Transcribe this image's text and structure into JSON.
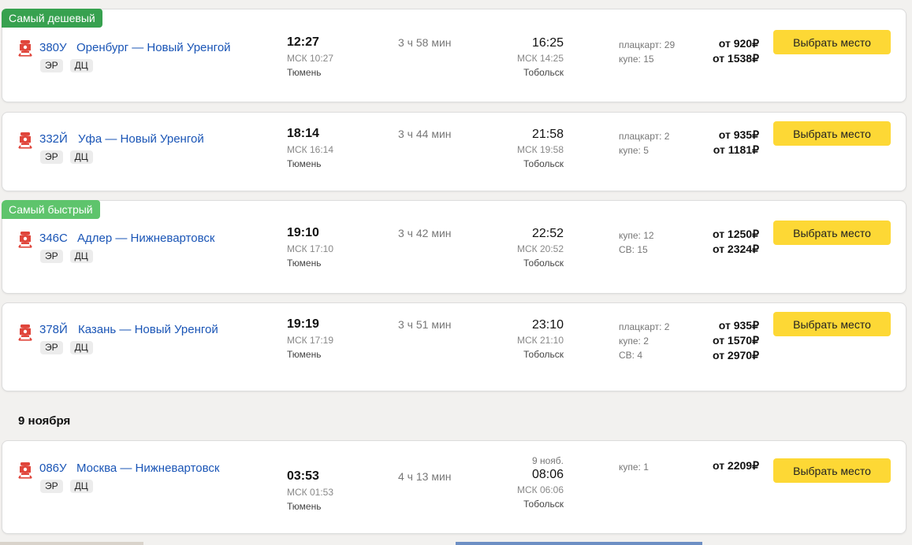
{
  "trains": [
    {
      "badge": "Самый дешевый",
      "badge_type": "cheap",
      "number": "380У",
      "route": "Оренбург — Новый Уренгой",
      "tags": [
        "ЭР",
        "ДЦ"
      ],
      "dep_time": "12:27",
      "dep_msk": "МСК 10:27",
      "dep_city": "Тюмень",
      "duration": "3 ч 58 мин",
      "arr_date": "",
      "arr_time": "16:25",
      "arr_msk": "МСК 14:25",
      "arr_city": "Тобольск",
      "classes": [
        "плацкарт: 29",
        "купе: 15"
      ],
      "prices": [
        "от 920₽",
        "от 1538₽"
      ],
      "button": "Выбрать место"
    },
    {
      "badge": "",
      "badge_type": "",
      "number": "332Й",
      "route": "Уфа — Новый Уренгой",
      "tags": [
        "ЭР",
        "ДЦ"
      ],
      "dep_time": "18:14",
      "dep_msk": "МСК 16:14",
      "dep_city": "Тюмень",
      "duration": "3 ч 44 мин",
      "arr_date": "",
      "arr_time": "21:58",
      "arr_msk": "МСК 19:58",
      "arr_city": "Тобольск",
      "classes": [
        "плацкарт: 2",
        "купе: 5"
      ],
      "prices": [
        "от 935₽",
        "от 1181₽"
      ],
      "button": "Выбрать место"
    },
    {
      "badge": "Самый быстрый",
      "badge_type": "fast",
      "number": "346С",
      "route": "Адлер — Нижневартовск",
      "tags": [
        "ЭР",
        "ДЦ"
      ],
      "dep_time": "19:10",
      "dep_msk": "МСК 17:10",
      "dep_city": "Тюмень",
      "duration": "3 ч 42 мин",
      "arr_date": "",
      "arr_time": "22:52",
      "arr_msk": "МСК 20:52",
      "arr_city": "Тобольск",
      "classes": [
        "купе: 12",
        "СВ: 15"
      ],
      "prices": [
        "от 1250₽",
        "от 2324₽"
      ],
      "button": "Выбрать место"
    },
    {
      "badge": "",
      "badge_type": "",
      "number": "378Й",
      "route": "Казань — Новый Уренгой",
      "tags": [
        "ЭР",
        "ДЦ"
      ],
      "dep_time": "19:19",
      "dep_msk": "МСК 17:19",
      "dep_city": "Тюмень",
      "duration": "3 ч 51 мин",
      "arr_date": "",
      "arr_time": "23:10",
      "arr_msk": "МСК 21:10",
      "arr_city": "Тобольск",
      "classes": [
        "плацкарт: 2",
        "купе: 2",
        "СВ: 4"
      ],
      "prices": [
        "от 935₽",
        "от 1570₽",
        "от 2970₽"
      ],
      "button": "Выбрать место"
    },
    {
      "badge": "",
      "badge_type": "",
      "number": "086У",
      "route": "Москва — Нижневартовск",
      "tags": [
        "ЭР",
        "ДЦ"
      ],
      "dep_time": "03:53",
      "dep_msk": "МСК 01:53",
      "dep_city": "Тюмень",
      "duration": "4 ч 13 мин",
      "arr_date": "9 нояб.",
      "arr_time": "08:06",
      "arr_msk": "МСК 06:06",
      "arr_city": "Тобольск",
      "classes": [
        "купе: 1"
      ],
      "prices": [
        "от 2209₽"
      ],
      "button": "Выбрать место"
    }
  ],
  "date_header": "9 ноября",
  "colors": {
    "badge_cheap": "#37a14f",
    "badge_fast": "#5ec46c",
    "link": "#1a55b6",
    "button": "#fdd835",
    "train_icon": "#e0453b"
  },
  "icons": {
    "train": "train-icon"
  }
}
